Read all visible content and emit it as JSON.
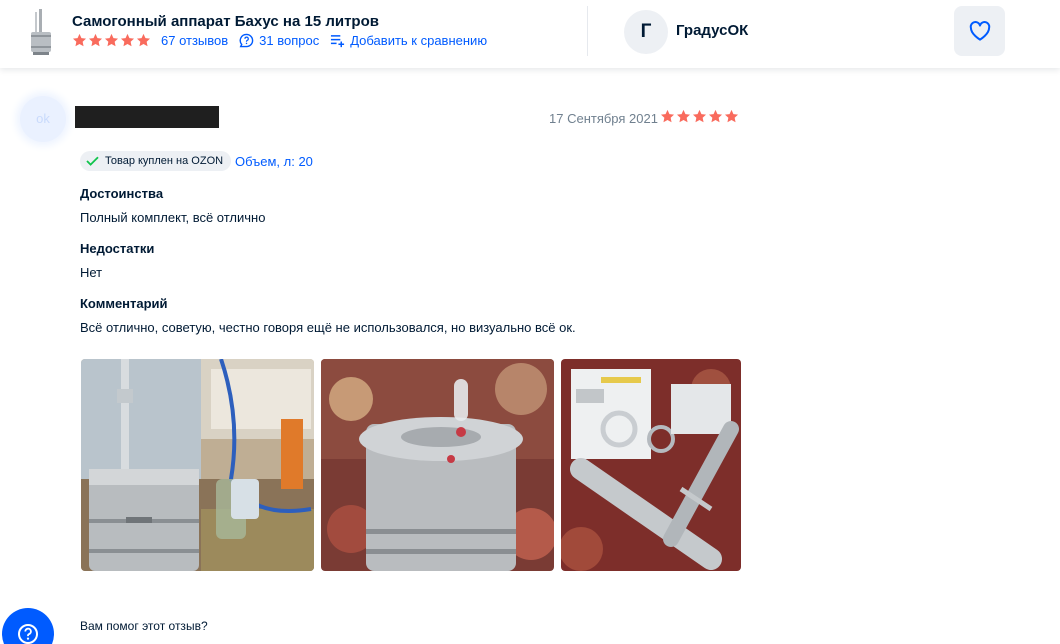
{
  "header": {
    "product_title": "Самогонный аппарат Бахус на 15 литров",
    "rating": 5,
    "reviews_label": "67 отзывов",
    "questions_label": "31 вопрос",
    "compare_label": "Добавить к сравнению",
    "seller_initial": "Г",
    "seller_name": "ГрадусОК",
    "icons": {
      "questions": "speech-bubble-icon",
      "compare": "add-to-compare-icon",
      "favorite": "heart-icon"
    }
  },
  "review": {
    "date": "17 Сентября 2021",
    "rating": 5,
    "bought_badge": "Товар куплен на OZON",
    "volume": "Объем, л: 20",
    "sections": [
      {
        "heading": "Достоинства",
        "text": "Полный комплект, всё отлично"
      },
      {
        "heading": "Недостатки",
        "text": "Нет"
      },
      {
        "heading": "Комментарий",
        "text": "Всё отлично, советую, честно говоря ещё не использовался, но визуально всё ок."
      }
    ],
    "photos_count": 3,
    "helpful_question": "Вам помог этот отзыв?"
  },
  "colors": {
    "accent": "#005bff",
    "star": "#f96b5d",
    "text": "#001a34",
    "muted": "#70808f",
    "chip_bg": "#edf0f4",
    "check": "#10c44c"
  }
}
